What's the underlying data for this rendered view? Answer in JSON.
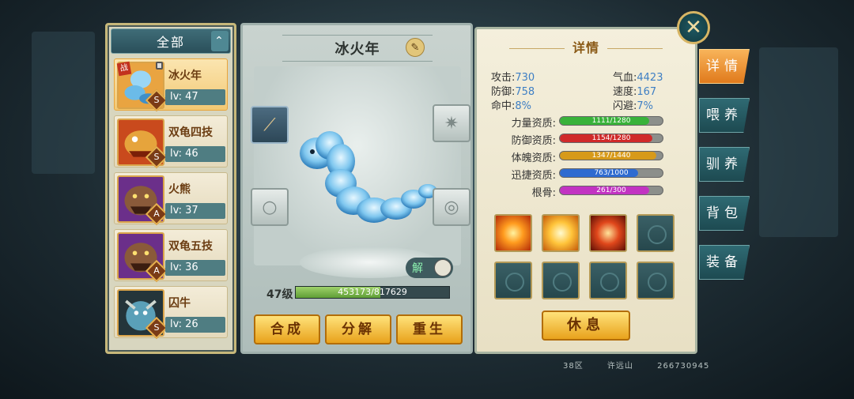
{
  "filter": {
    "label": "全部",
    "toggle": "⌃"
  },
  "pets": [
    {
      "name": "冰火年",
      "level": "lv: 47",
      "grade": "S",
      "selected": true,
      "battle_tag": "战",
      "colors": [
        "#9ad6f5",
        "#3f8fc8"
      ]
    },
    {
      "name": "双龟四技",
      "level": "lv: 46",
      "grade": "S",
      "selected": false,
      "colors": [
        "#e6a43c",
        "#9a3b12"
      ]
    },
    {
      "name": "火熊",
      "level": "lv: 37",
      "grade": "A",
      "selected": false,
      "colors": [
        "#8a5a3a",
        "#3b1d10"
      ]
    },
    {
      "name": "双龟五技",
      "level": "lv: 36",
      "grade": "A",
      "selected": false,
      "colors": [
        "#8a5a3a",
        "#3b1d10"
      ]
    },
    {
      "name": "囚牛",
      "level": "lv: 26",
      "grade": "S",
      "selected": false,
      "colors": [
        "#5aa0b8",
        "#24353a"
      ]
    }
  ],
  "pet_detail": {
    "name": "冰火年",
    "rename_icon": "✎",
    "unlock_label": "解",
    "level_label": "47级",
    "exp_text": "453173/817629",
    "exp_progress": 0.554
  },
  "actions": {
    "synthesize": "合成",
    "decompose": "分解",
    "reborn": "重生"
  },
  "details": {
    "title": "详情",
    "stats": {
      "attack_label": "攻击:",
      "attack": "730",
      "hp_label": "气血:",
      "hp": "4423",
      "defense_label": "防御:",
      "defense": "758",
      "speed_label": "速度:",
      "speed": "167",
      "hit_label": "命中:",
      "hit": "8%",
      "dodge_label": "闪避:",
      "dodge": "7%"
    },
    "aptitudes": [
      {
        "label": "力量资质:",
        "text": "1111/1280",
        "value": 0.868,
        "color": "#39b23a"
      },
      {
        "label": "防御资质:",
        "text": "1154/1280",
        "value": 0.902,
        "color": "#d02a2a"
      },
      {
        "label": "体魄资质:",
        "text": "1347/1440",
        "value": 0.935,
        "color": "#d79a1a"
      },
      {
        "label": "迅捷资质:",
        "text": "763/1000",
        "value": 0.763,
        "color": "#2f6bd0"
      },
      {
        "label": "根骨:",
        "text": "261/300",
        "value": 0.87,
        "color": "#c233c2"
      }
    ],
    "skills": [
      "fire-skill-icon",
      "sun-skill-icon",
      "swirl-skill-icon",
      "empty",
      "empty",
      "empty",
      "empty",
      "empty"
    ],
    "rest_label": "休息"
  },
  "tabs": [
    "详情",
    "喂养",
    "驯养",
    "背包",
    "装备"
  ],
  "close_icon": "✕",
  "footer": {
    "server": "38区",
    "player": "许远山",
    "id": "266730945"
  }
}
